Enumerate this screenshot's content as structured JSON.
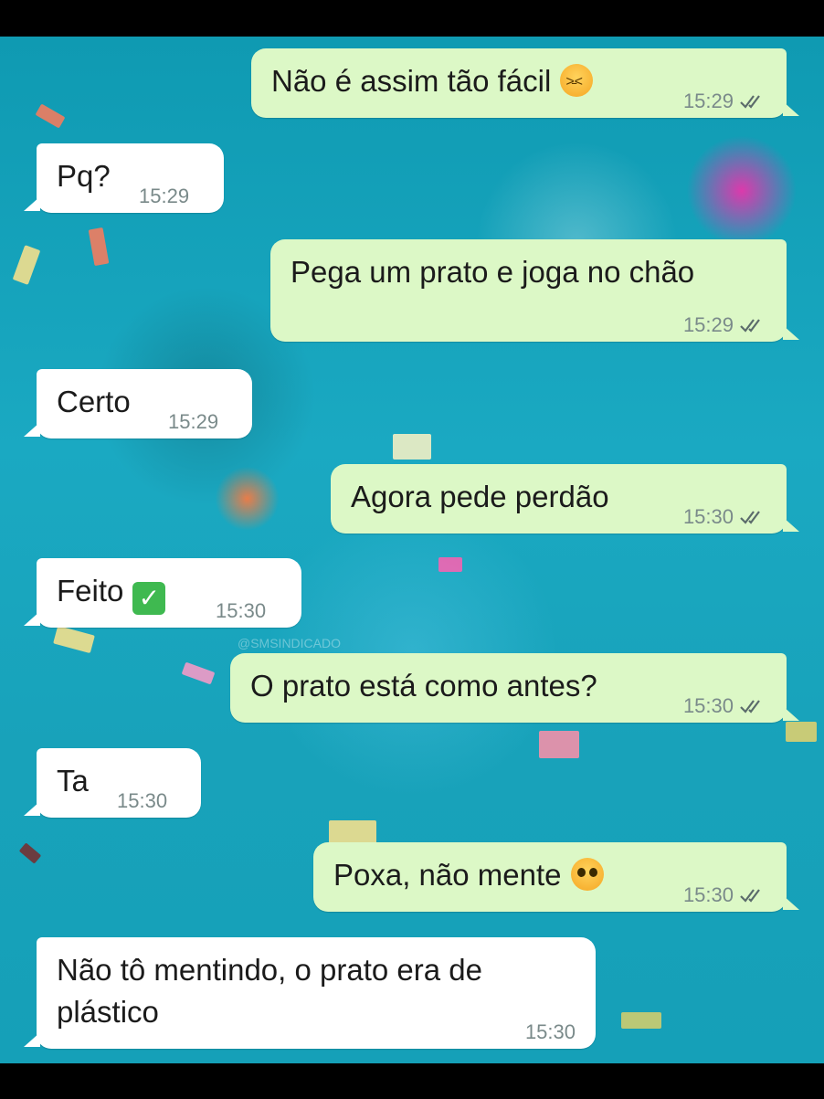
{
  "messages": [
    {
      "text": "Não é assim tão fácil",
      "emoji": "angry-face-icon",
      "time": "15:29",
      "direction": "out",
      "read": true
    },
    {
      "text": "Pq?",
      "time": "15:29",
      "direction": "in"
    },
    {
      "text": "Pega um prato e joga no chão",
      "time": "15:29",
      "direction": "out",
      "read": true
    },
    {
      "text": "Certo",
      "time": "15:29",
      "direction": "in"
    },
    {
      "text": "Agora pede perdão",
      "time": "15:30",
      "direction": "out",
      "read": true
    },
    {
      "text": "Feito",
      "emoji": "check-mark-button-icon",
      "time": "15:30",
      "direction": "in"
    },
    {
      "text": "O prato está como antes?",
      "time": "15:30",
      "direction": "out",
      "read": true
    },
    {
      "text": "Ta",
      "time": "15:30",
      "direction": "in"
    },
    {
      "text": "Poxa, não mente",
      "emoji": "pleading-face-icon",
      "time": "15:30",
      "direction": "out",
      "read": true
    },
    {
      "line1": "Não tô mentindo, o prato era de",
      "line2": "plástico",
      "time": "15:30",
      "direction": "in"
    }
  ],
  "watermark": "@SMSINDICADO",
  "colors": {
    "outgoing_bubble": "#dcf8c6",
    "incoming_bubble": "#ffffff",
    "read_tick": "#4fa3c7",
    "background": "#15a0b8"
  }
}
